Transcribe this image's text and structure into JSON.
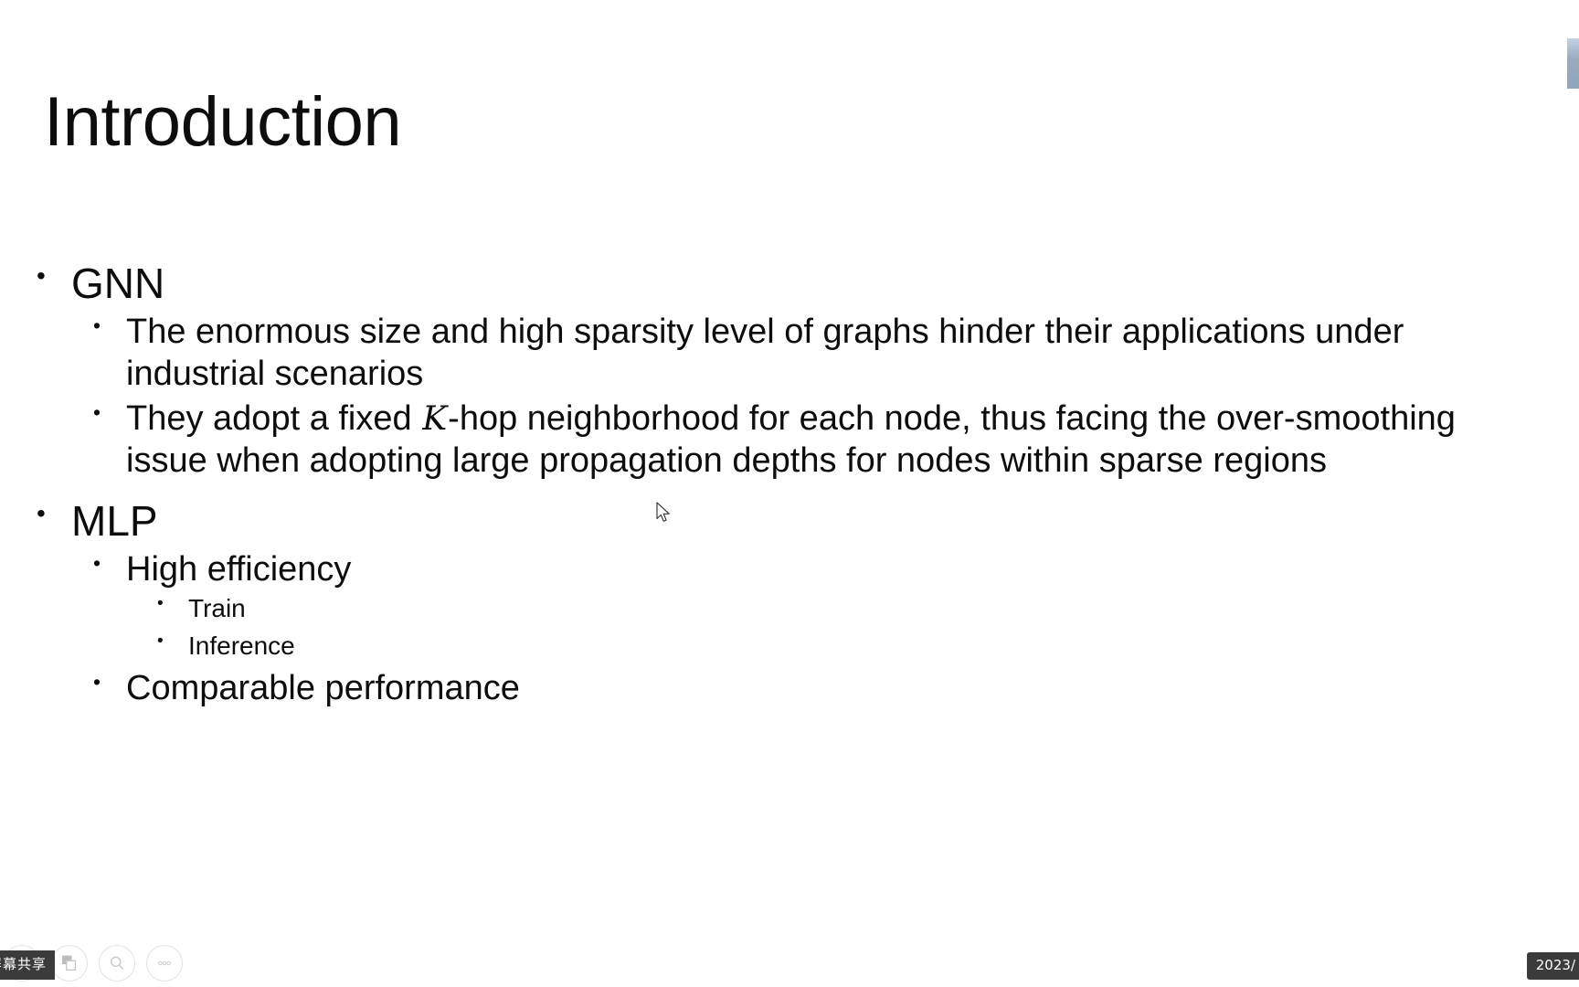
{
  "slide": {
    "title": "Introduction",
    "bullets": [
      {
        "level": 1,
        "text": "GNN"
      },
      {
        "level": 2,
        "text": "The enormous size and high sparsity level of graphs hinder their applications under industrial scenarios"
      },
      {
        "level": 2,
        "text_before_var": "They adopt a fixed ",
        "variable": "K",
        "text_after_var": "-hop neighborhood for each node, thus facing the over-smoothing issue when adopting large propagation depths for nodes within sparse regions"
      },
      {
        "level": 1,
        "text": "MLP"
      },
      {
        "level": 2,
        "text": "High efficiency"
      },
      {
        "level": 3,
        "text": "Train"
      },
      {
        "level": 3,
        "text": "Inference"
      },
      {
        "level": 2,
        "text": "Comparable performance"
      }
    ],
    "bullet_glyph": "•"
  },
  "toolbar": {
    "tooltip_label": "屏幕共享",
    "buttons": [
      {
        "name": "annotate-pen",
        "label": "annotate"
      },
      {
        "name": "screenshot-copy",
        "label": "screenshot"
      },
      {
        "name": "zoom-magnifier",
        "label": "zoom"
      },
      {
        "name": "more-options",
        "label": "more"
      }
    ]
  },
  "status": {
    "timestamp": "2023/"
  },
  "colors": {
    "background": "#ffffff",
    "text": "#0d0d0d",
    "tooltip_bg": "#3b3b3b",
    "tooltip_text": "#ffffff",
    "scroll_indicator": "#9aabc0",
    "toolbar_icon": "#c9c9c9"
  }
}
